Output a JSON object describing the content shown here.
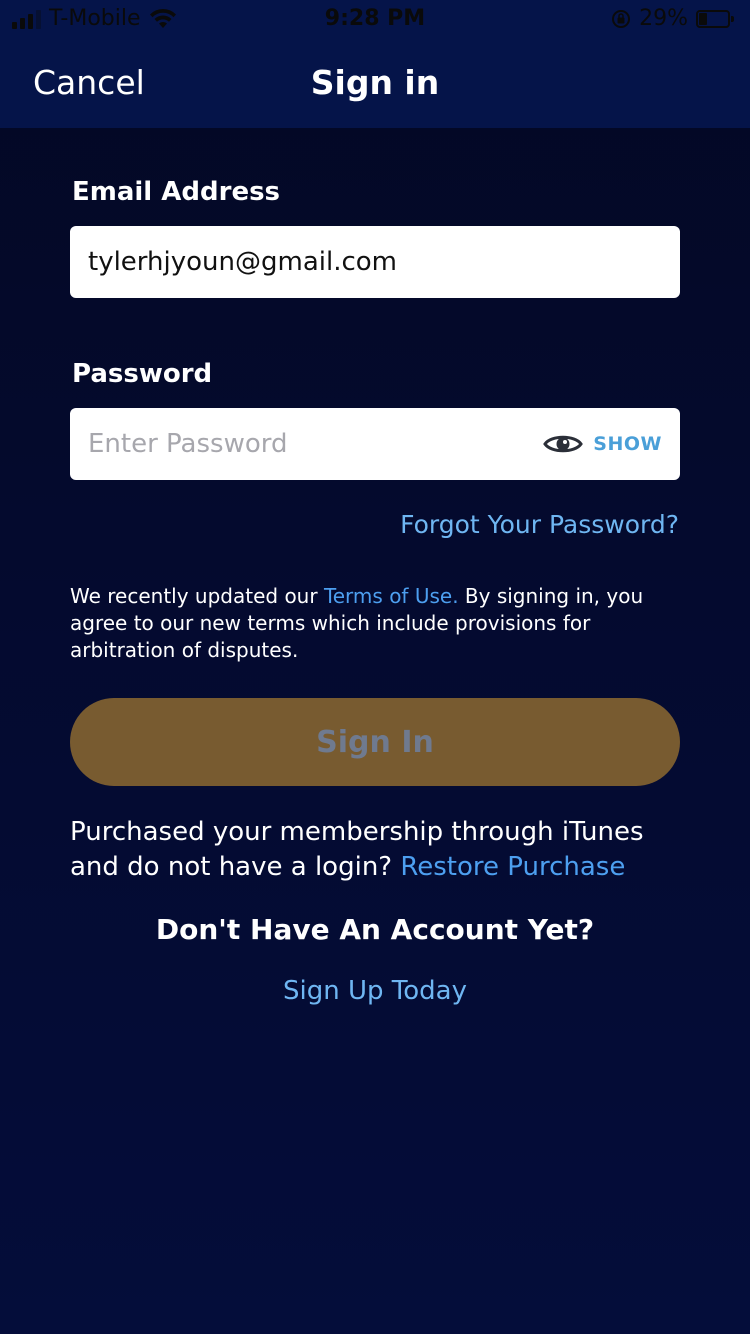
{
  "status_bar": {
    "carrier": "T-Mobile",
    "time": "9:28 PM",
    "battery": "29%"
  },
  "nav": {
    "cancel": "Cancel",
    "title": "Sign in"
  },
  "form": {
    "email_label": "Email Address",
    "email_value": "tylerhjyoun@gmail.com",
    "password_label": "Password",
    "password_placeholder": "Enter Password",
    "show_label": "SHOW",
    "forgot": "Forgot Your Password?"
  },
  "terms": {
    "before": "We recently updated our ",
    "link": "Terms of Use.",
    "after": " By signing in, you agree to our new terms which include provisions for arbitration of disputes."
  },
  "signin_button": "Sign In",
  "restore": {
    "text": "Purchased your membership through iTunes and do not have a login? ",
    "link": "Restore Purchase"
  },
  "account": {
    "heading": "Don't Have An Account Yet?",
    "signup": "Sign Up Today"
  },
  "colors": {
    "nav_bg": "#051449",
    "page_bg": "#040a2e",
    "link": "#4d9ff0",
    "button_bg": "#785b30",
    "button_text": "#6f7a8f"
  }
}
